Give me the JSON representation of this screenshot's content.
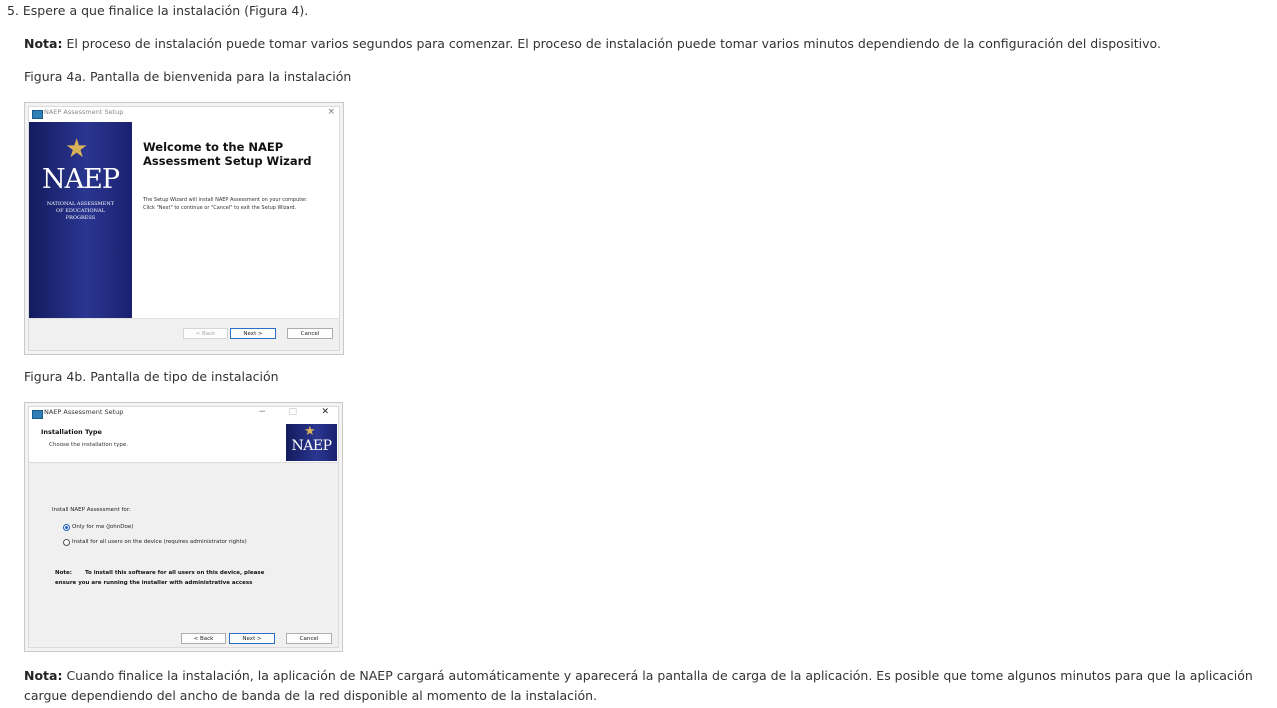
{
  "step": {
    "text": "5. Espere a que finalice la instalación (Figura 4)."
  },
  "note1": {
    "label": "Nota:",
    "text": " El proceso de instalación puede tomar varios segundos para comenzar. El proceso de instalación puede tomar varios minutos dependiendo de la configuración del dispositivo."
  },
  "figure_a": {
    "caption": "Figura 4a. Pantalla de bienvenida para la instalación",
    "window_title": "NAEP Assessment Setup",
    "close_glyph": "×",
    "logo_text": "NAEP",
    "logo_subtitle": "NATIONAL ASSESSMENT\nOF EDUCATIONAL\nPROGRESS",
    "heading_line1": "Welcome to the NAEP",
    "heading_line2": "Assessment  Setup  Wizard",
    "body_line1": "The Setup Wizard will install NAEP Assessment on your computer.",
    "body_line2": "Click \"Next\" to continue or \"Cancel\" to exit the Setup Wizard.",
    "buttons": {
      "back": "< Back",
      "next": "Next >",
      "cancel": "Cancel"
    }
  },
  "figure_b": {
    "caption": "Figura 4b. Pantalla de tipo de instalación",
    "window_title": "NAEP Assessment Setup",
    "minimize_glyph": "−",
    "maximize_glyph": "□",
    "close_glyph": "✕",
    "header_title": "Installation Type",
    "header_subtitle": "Choose the installation type.",
    "logo_text": "NAEP",
    "install_for_label": "Install NAEP Assessment  for:",
    "options": [
      {
        "label": "Only for me (JohnDoe)",
        "selected": true
      },
      {
        "label": "Install for all users on the device (requires administrator rights)",
        "selected": false
      }
    ],
    "note_label": "Note:",
    "note_line1": "To install this software for all users on this device, please",
    "note_line2": "ensure you  are running the installer with administrative access",
    "buttons": {
      "back": "< Back",
      "next": "Next >",
      "cancel": "Cancel"
    }
  },
  "note2": {
    "label": "Nota:",
    "text": " Cuando finalice la instalación, la aplicación de NAEP cargará automáticamente y aparecerá la pantalla de carga de la aplicación. Es posible que tome algunos minutos para que la aplicación cargue dependiendo del ancho de banda de la red disponible al momento de la instalación."
  }
}
